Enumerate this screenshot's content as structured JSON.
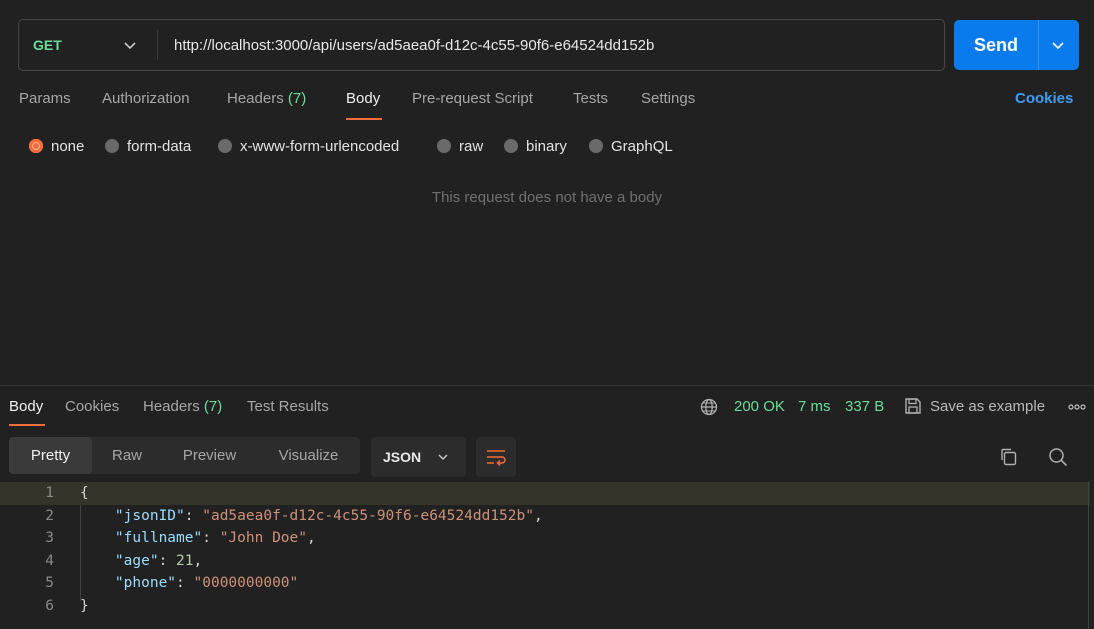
{
  "request": {
    "method": "GET",
    "url": "http://localhost:3000/api/users/ad5aea0f-d12c-4c55-90f6-e64524dd152b",
    "send_label": "Send"
  },
  "request_tabs": [
    {
      "label": "Params"
    },
    {
      "label": "Authorization"
    },
    {
      "label": "Headers",
      "count": "(7)"
    },
    {
      "label": "Body",
      "active": true
    },
    {
      "label": "Pre-request Script"
    },
    {
      "label": "Tests"
    },
    {
      "label": "Settings"
    }
  ],
  "cookies_link": "Cookies",
  "body_types": [
    {
      "label": "none",
      "selected": true
    },
    {
      "label": "form-data"
    },
    {
      "label": "x-www-form-urlencoded"
    },
    {
      "label": "raw"
    },
    {
      "label": "binary"
    },
    {
      "label": "GraphQL"
    }
  ],
  "empty_body_message": "This request does not have a body",
  "response_tabs": [
    {
      "label": "Body",
      "active": true
    },
    {
      "label": "Cookies"
    },
    {
      "label": "Headers",
      "count": "(7)"
    },
    {
      "label": "Test Results"
    }
  ],
  "response_status": {
    "status": "200 OK",
    "time": "7 ms",
    "size": "337 B",
    "save_label": "Save as example",
    "more": "ooo"
  },
  "view_modes": [
    "Pretty",
    "Raw",
    "Preview",
    "Visualize"
  ],
  "active_view": "Pretty",
  "format": "JSON",
  "code_lines": [
    {
      "n": "1",
      "text": "{"
    },
    {
      "n": "2",
      "text": "    \"jsonID\": \"ad5aea0f-d12c-4c55-90f6-e64524dd152b\","
    },
    {
      "n": "3",
      "text": "    \"fullname\": \"John Doe\","
    },
    {
      "n": "4",
      "text": "    \"age\": 21,"
    },
    {
      "n": "5",
      "text": "    \"phone\": \"0000000000\""
    },
    {
      "n": "6",
      "text": "}"
    }
  ],
  "colors": {
    "accent": "#f26b3a",
    "send": "#097bed",
    "success": "#6bdd9a",
    "link": "#3d9ef5"
  },
  "icons": [
    "chevron-down-icon",
    "globe-icon",
    "save-icon",
    "copy-icon",
    "search-icon",
    "wrap-lines-icon"
  ]
}
